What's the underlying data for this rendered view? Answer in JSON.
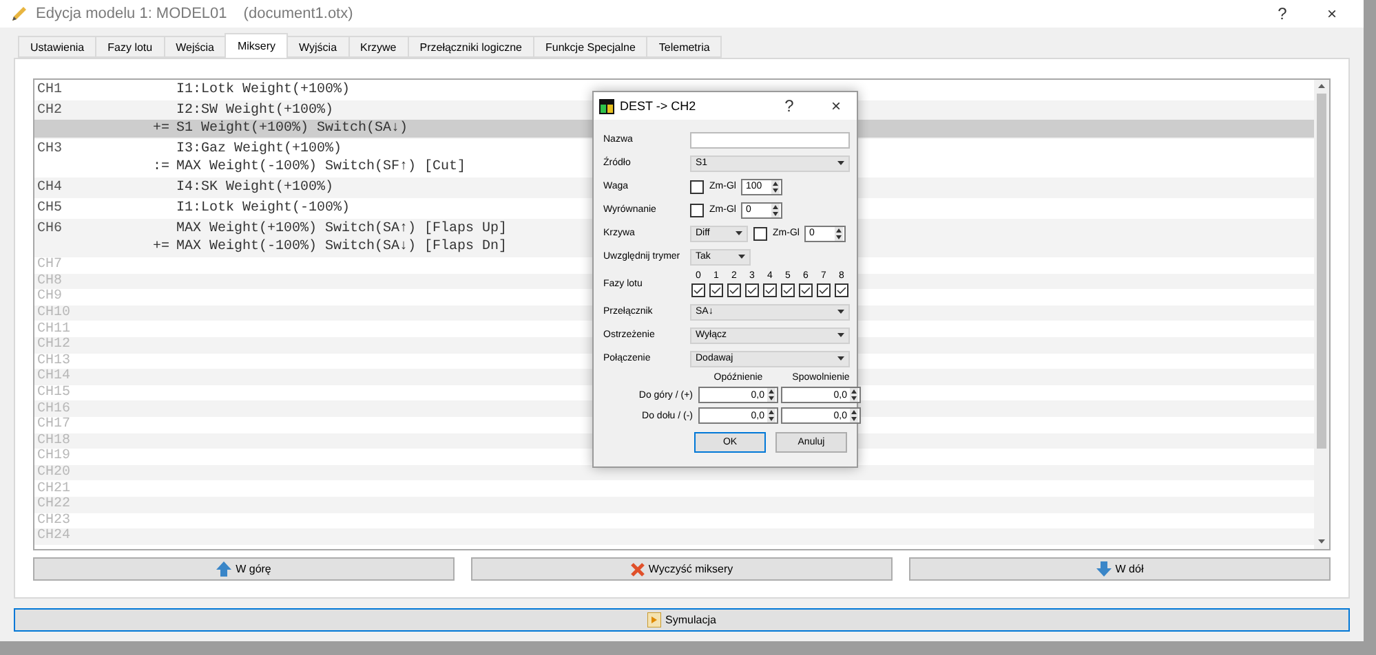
{
  "window": {
    "title": "Edycja modelu 1: MODEL01",
    "document": "(document1.otx)",
    "help": "?",
    "close": "×"
  },
  "tabs": [
    {
      "label": "Ustawienia",
      "selected": false
    },
    {
      "label": "Fazy lotu",
      "selected": false
    },
    {
      "label": "Wejścia",
      "selected": false
    },
    {
      "label": "Miksery",
      "selected": true
    },
    {
      "label": "Wyjścia",
      "selected": false
    },
    {
      "label": "Krzywe",
      "selected": false
    },
    {
      "label": "Przełączniki logiczne",
      "selected": false
    },
    {
      "label": "Funkcje Specjalne",
      "selected": false
    },
    {
      "label": "Telemetria",
      "selected": false
    }
  ],
  "mixers": [
    {
      "channel": "CH1",
      "used": true,
      "lines": [
        {
          "text": "I1:Lotk Weight(+100%)",
          "selected": false
        }
      ]
    },
    {
      "channel": "CH2",
      "used": true,
      "lines": [
        {
          "text": "I2:SW Weight(+100%)",
          "selected": false
        },
        {
          "prefix": "+=",
          "text": "S1 Weight(+100%) Switch(SA↓)",
          "selected": true
        }
      ]
    },
    {
      "channel": "CH3",
      "used": true,
      "lines": [
        {
          "text": "I3:Gaz Weight(+100%)",
          "selected": false
        },
        {
          "prefix": ":=",
          "text": "MAX Weight(-100%) Switch(SF↑) [Cut]",
          "selected": false
        }
      ]
    },
    {
      "channel": "CH4",
      "used": true,
      "lines": [
        {
          "text": "I4:SK Weight(+100%)",
          "selected": false
        }
      ]
    },
    {
      "channel": "CH5",
      "used": true,
      "lines": [
        {
          "text": "I1:Lotk Weight(-100%)",
          "selected": false
        }
      ]
    },
    {
      "channel": "CH6",
      "used": true,
      "lines": [
        {
          "text": "MAX Weight(+100%) Switch(SA↑) [Flaps Up]",
          "selected": false
        },
        {
          "prefix": "+=",
          "text": "MAX Weight(-100%) Switch(SA↓) [Flaps Dn]",
          "selected": false
        }
      ]
    },
    {
      "channel": "CH7",
      "used": false
    },
    {
      "channel": "CH8",
      "used": false
    },
    {
      "channel": "CH9",
      "used": false
    },
    {
      "channel": "CH10",
      "used": false
    },
    {
      "channel": "CH11",
      "used": false
    },
    {
      "channel": "CH12",
      "used": false
    },
    {
      "channel": "CH13",
      "used": false
    },
    {
      "channel": "CH14",
      "used": false
    },
    {
      "channel": "CH15",
      "used": false
    },
    {
      "channel": "CH16",
      "used": false
    },
    {
      "channel": "CH17",
      "used": false
    },
    {
      "channel": "CH18",
      "used": false
    },
    {
      "channel": "CH19",
      "used": false
    },
    {
      "channel": "CH20",
      "used": false
    },
    {
      "channel": "CH21",
      "used": false
    },
    {
      "channel": "CH22",
      "used": false
    },
    {
      "channel": "CH23",
      "used": false
    },
    {
      "channel": "CH24",
      "used": false
    }
  ],
  "list_buttons": [
    {
      "label": "W górę",
      "kind": "up"
    },
    {
      "label": "Wyczyść miksery",
      "kind": "clear"
    },
    {
      "label": "W dół",
      "kind": "down"
    }
  ],
  "simulate_button": {
    "label": "Symulacja"
  },
  "dialog": {
    "title": "DEST -> CH2",
    "help": "?",
    "close": "×",
    "fields": [
      {
        "kind": "text",
        "label": "Nazwa"
      },
      {
        "kind": "select",
        "label": "Źródło",
        "value": "S1"
      },
      {
        "kind": "check_spin",
        "label": "Waga",
        "check_label": "Zm-Gl",
        "checked": false,
        "value": "100"
      },
      {
        "kind": "check_spin",
        "label": "Wyrównanie",
        "check_label": "Zm-Gl",
        "checked": false,
        "value": "0"
      },
      {
        "kind": "select_check_spin",
        "label": "Krzywa",
        "value": "Diff",
        "check_label": "Zm-Gl",
        "checked": false,
        "spin": "0"
      },
      {
        "kind": "short_select",
        "label": "Uwzględnij trymer",
        "value": "Tak"
      },
      {
        "kind": "phases",
        "label": "Fazy lotu",
        "phases": [
          {
            "label": "0",
            "checked": true
          },
          {
            "label": "1",
            "checked": true
          },
          {
            "label": "2",
            "checked": true
          },
          {
            "label": "3",
            "checked": true
          },
          {
            "label": "4",
            "checked": true
          },
          {
            "label": "5",
            "checked": true
          },
          {
            "label": "6",
            "checked": true
          },
          {
            "label": "7",
            "checked": true
          },
          {
            "label": "8",
            "checked": true
          }
        ]
      },
      {
        "kind": "select",
        "label": "Przełącznik",
        "value": "SA↓"
      },
      {
        "kind": "select",
        "label": "Ostrzeżenie",
        "value": "Wyłącz"
      },
      {
        "kind": "select",
        "label": "Połączenie",
        "value": "Dodawaj"
      }
    ],
    "timing": {
      "columns": [
        "Opóźnienie",
        "Spowolnienie"
      ],
      "rows": [
        {
          "label": "Do góry / (+)",
          "values": [
            "0,0",
            "0,0"
          ]
        },
        {
          "label": "Do dołu / (-)",
          "values": [
            "0,0",
            "0,0"
          ]
        }
      ]
    },
    "buttons": [
      {
        "label": "OK",
        "default": true
      },
      {
        "label": "Anuluj",
        "default": false
      }
    ]
  }
}
